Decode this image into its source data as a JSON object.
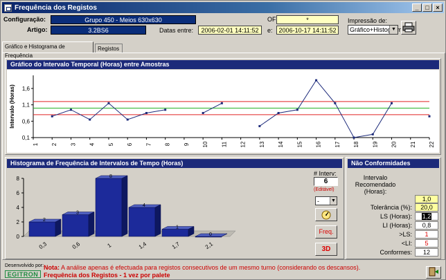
{
  "window": {
    "title": "Frequência dos Registos",
    "buttons": [
      "_",
      "□",
      "×"
    ]
  },
  "header": {
    "config_label": "Configuração:",
    "config_value": "Grupo 450 - Meios 630x630",
    "artigo_label": "Artigo:",
    "artigo_value": "3.2BS6",
    "of_label": "OF:",
    "of_value": "*",
    "datas_label": "Datas entre:",
    "date_from": "2006-02-01 14:11:52",
    "e_label": "e:",
    "date_to": "2006-10-17 14:11:52",
    "impressao_label": "Impressão de:",
    "impressao_value": "Gráfico+Histograma"
  },
  "tabs": [
    {
      "label": "Gráfico e Histograma de Frequência",
      "active": true
    },
    {
      "label": "Registos",
      "active": false
    }
  ],
  "line_chart": {
    "title": "Gráfico do Intervalo Temporal (Horas) entre Amostras",
    "ylabel": "Intervalo (Horas)",
    "yticks": [
      "1,6",
      "1,1",
      "0,6",
      "0,1"
    ],
    "colors": {
      "upper": "#e02020",
      "center": "#20b020",
      "lower": "#e02020",
      "series": "#1c2a7a"
    }
  },
  "histogram": {
    "title": "Histograma de Frequência de Intervalos de Tempo (Horas)",
    "yticks": [
      "8",
      "6",
      "4",
      "2",
      "0"
    ],
    "ninterv_label": "# Interv:",
    "ninterv_value": "6",
    "editavel": "(Editável)",
    "freq_button": "Freq.",
    "threed_button": "3D",
    "minus_value": "-"
  },
  "nc": {
    "title": "Não Conformidades",
    "rows": [
      {
        "label": "Intervalo Recomendado (Horas):",
        "value": "1,0",
        "style": "yel"
      },
      {
        "label": "Tolerância (%):",
        "value": "20,0",
        "style": "yel"
      },
      {
        "label": "LS (Horas):",
        "value": "1,2",
        "style": "sel"
      },
      {
        "label": "LI (Horas):",
        "value": "0,8",
        "style": ""
      },
      {
        "label": ">LS:",
        "value": "1",
        "style": "red"
      },
      {
        "label": "<LI:",
        "value": "5",
        "style": "red"
      },
      {
        "label": "Conformes:",
        "value": "12",
        "style": ""
      }
    ]
  },
  "footer": {
    "dev_label": "Desenvolvido por:",
    "logo_text": "EGITRON",
    "nota_label": "Nota:",
    "nota_text": "A análise apenas é efectuada para registos consecutivos de um mesmo turno (considerando os descansos).",
    "subtitle": "Frequência dos Registos - 1 vez por palete"
  },
  "chart_data": [
    {
      "type": "line",
      "title": "Gráfico do Intervalo Temporal (Horas) entre Amostras",
      "ylabel": "Intervalo (Horas)",
      "x": [
        1,
        2,
        3,
        4,
        5,
        6,
        7,
        8,
        9,
        10,
        11,
        12,
        13,
        14,
        15,
        16,
        17,
        18,
        19,
        20,
        21,
        22
      ],
      "series": [
        {
          "values": [
            null,
            0.75,
            0.95,
            0.65,
            1.15,
            0.65,
            0.85,
            0.95,
            null,
            0.85,
            1.15,
            null,
            0.45,
            0.85,
            0.95,
            1.85,
            1.15,
            0.1,
            0.2,
            1.15,
            null,
            0.75
          ]
        }
      ],
      "limits": {
        "LS": 1.2,
        "center": 1.0,
        "LI": 0.8
      },
      "ylim": [
        0.1,
        2.0
      ],
      "xlim": [
        1,
        22
      ]
    },
    {
      "type": "bar",
      "title": "Histograma de Frequência de Intervalos de Tempo (Horas)",
      "categories": [
        "0,3",
        "0,6",
        "1",
        "1,4",
        "1,7",
        "2,1"
      ],
      "values": [
        2,
        3,
        8,
        4,
        1,
        0
      ],
      "ylim": [
        0,
        8
      ]
    }
  ]
}
